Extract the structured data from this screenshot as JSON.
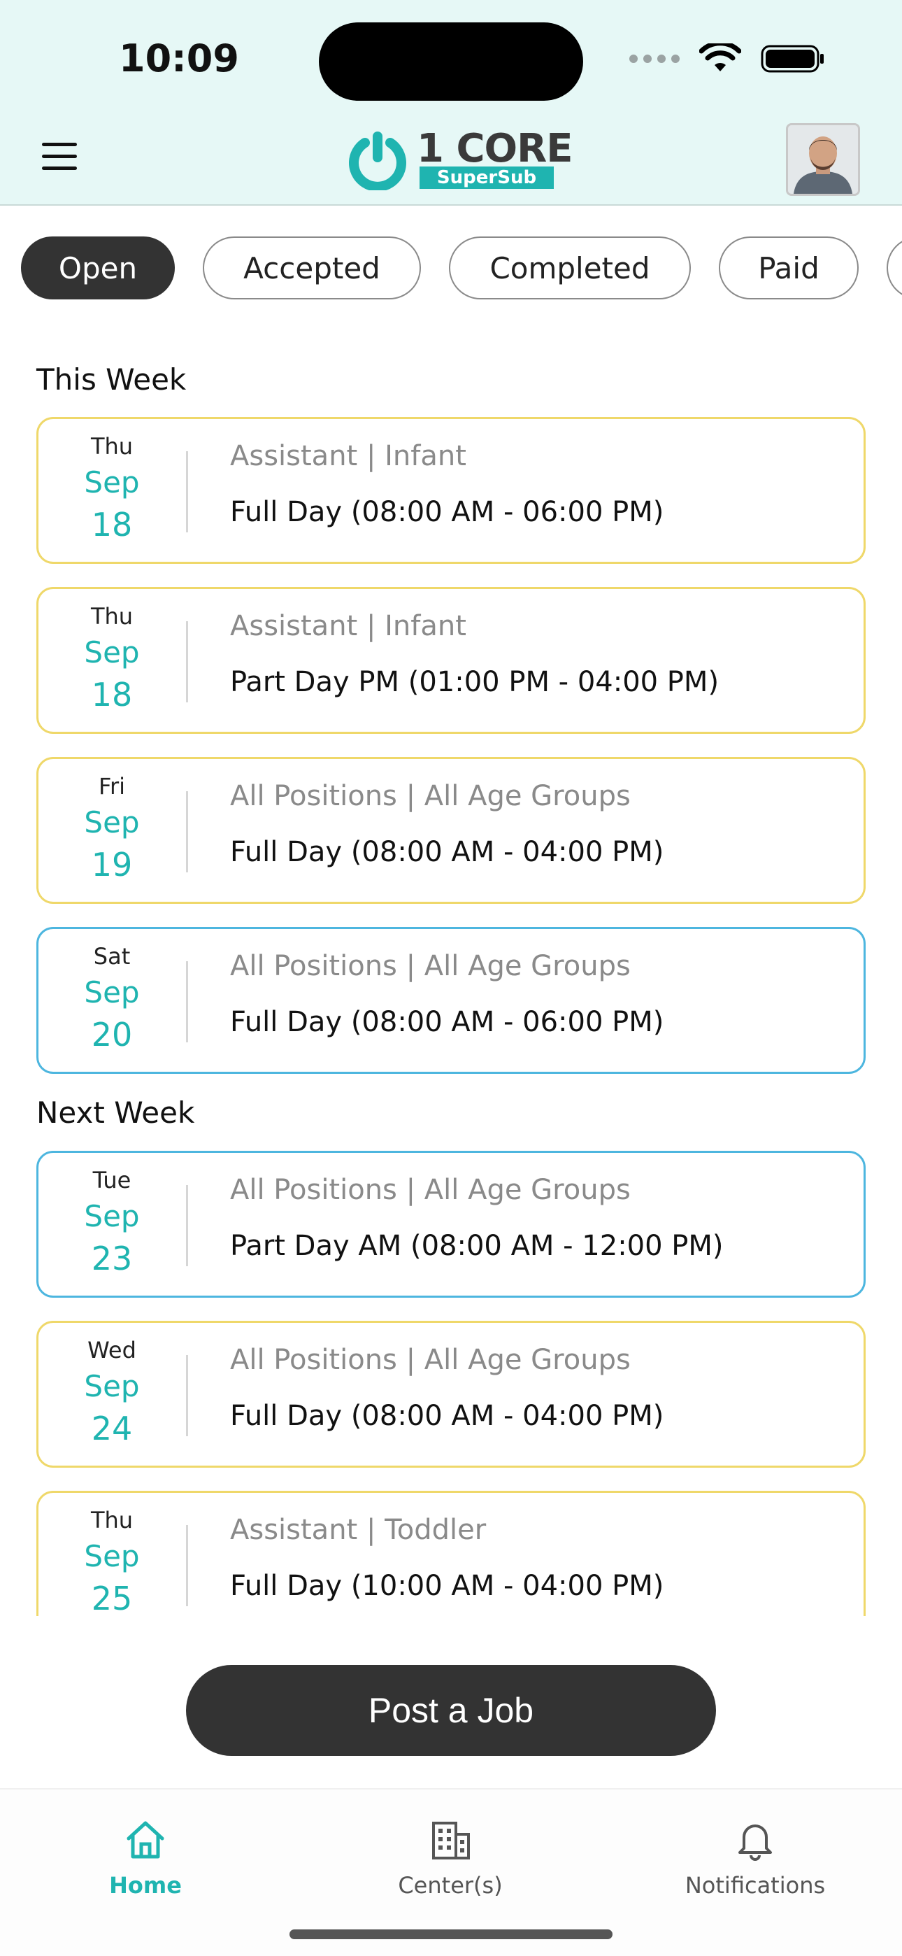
{
  "status_bar": {
    "time": "10:09"
  },
  "header": {
    "logo_text": "1 CORE",
    "logo_subtext": "SuperSub",
    "brand_color": "#1fb4b0"
  },
  "tabs": [
    {
      "label": "Open",
      "active": true
    },
    {
      "label": "Accepted",
      "active": false
    },
    {
      "label": "Completed",
      "active": false
    },
    {
      "label": "Paid",
      "active": false
    }
  ],
  "sections": [
    {
      "title": "This Week",
      "jobs": [
        {
          "dow": "Thu",
          "month": "Sep",
          "day": "18",
          "role": "Assistant | Infant",
          "shift": "Full Day (08:00 AM - 06:00 PM)",
          "border": "yellow"
        },
        {
          "dow": "Thu",
          "month": "Sep",
          "day": "18",
          "role": "Assistant | Infant",
          "shift": "Part Day PM (01:00 PM - 04:00 PM)",
          "border": "yellow"
        },
        {
          "dow": "Fri",
          "month": "Sep",
          "day": "19",
          "role": "All Positions | All Age Groups",
          "shift": "Full Day (08:00 AM - 04:00 PM)",
          "border": "yellow"
        },
        {
          "dow": "Sat",
          "month": "Sep",
          "day": "20",
          "role": "All Positions | All Age Groups",
          "shift": "Full Day (08:00 AM - 06:00 PM)",
          "border": "blue"
        }
      ]
    },
    {
      "title": "Next Week",
      "jobs": [
        {
          "dow": "Tue",
          "month": "Sep",
          "day": "23",
          "role": "All Positions | All Age Groups",
          "shift": "Part Day AM (08:00 AM - 12:00 PM)",
          "border": "blue"
        },
        {
          "dow": "Wed",
          "month": "Sep",
          "day": "24",
          "role": "All Positions | All Age Groups",
          "shift": "Full Day (08:00 AM - 04:00 PM)",
          "border": "yellow"
        },
        {
          "dow": "Thu",
          "month": "Sep",
          "day": "25",
          "role": "Assistant | Toddler",
          "shift": "Full Day (10:00 AM - 04:00 PM)",
          "border": "yellow"
        }
      ]
    }
  ],
  "post_button": {
    "label": "Post a Job"
  },
  "bottom_nav": [
    {
      "label": "Home",
      "icon": "home-icon",
      "active": true
    },
    {
      "label": "Center(s)",
      "icon": "building-icon",
      "active": false
    },
    {
      "label": "Notifications",
      "icon": "bell-icon",
      "active": false
    }
  ]
}
